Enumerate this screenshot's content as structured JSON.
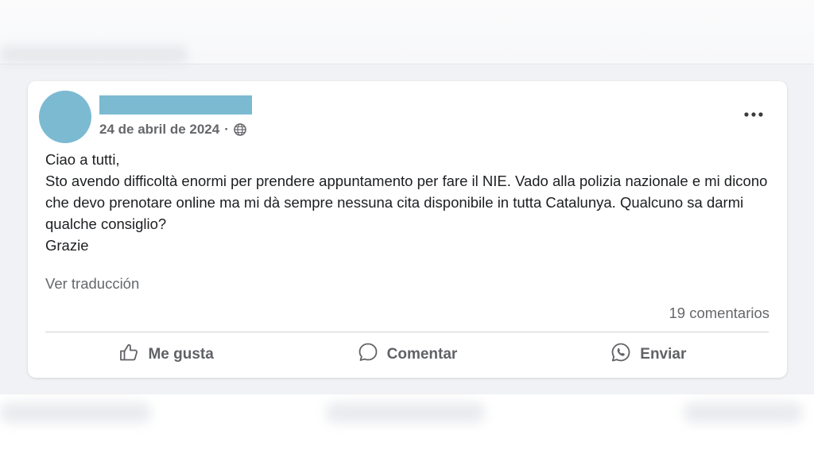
{
  "post": {
    "date": "24 de abril de 2024",
    "separator": "·",
    "privacy_icon": "globe-icon",
    "menu_icon": "more-horizontal-icon",
    "text_lines": [
      "Ciao a tutti,",
      "Sto avendo difficoltà enormi per prendere appuntamento per fare il NIE. Vado alla polizia nazionale e mi dicono che devo prenotare online ma mi dà sempre nessuna cita disponibile in tutta Catalunya. Qualcuno sa darmi qualche consiglio?",
      "Grazie"
    ],
    "translate_label": "Ver traducción",
    "comments_count": "19 comentarios"
  },
  "actions": {
    "like_label": "Me gusta",
    "comment_label": "Comentar",
    "send_label": "Enviar"
  },
  "colors": {
    "redaction": "#7cbad2",
    "secondary_text": "#65676b",
    "background": "#f0f2f5"
  }
}
